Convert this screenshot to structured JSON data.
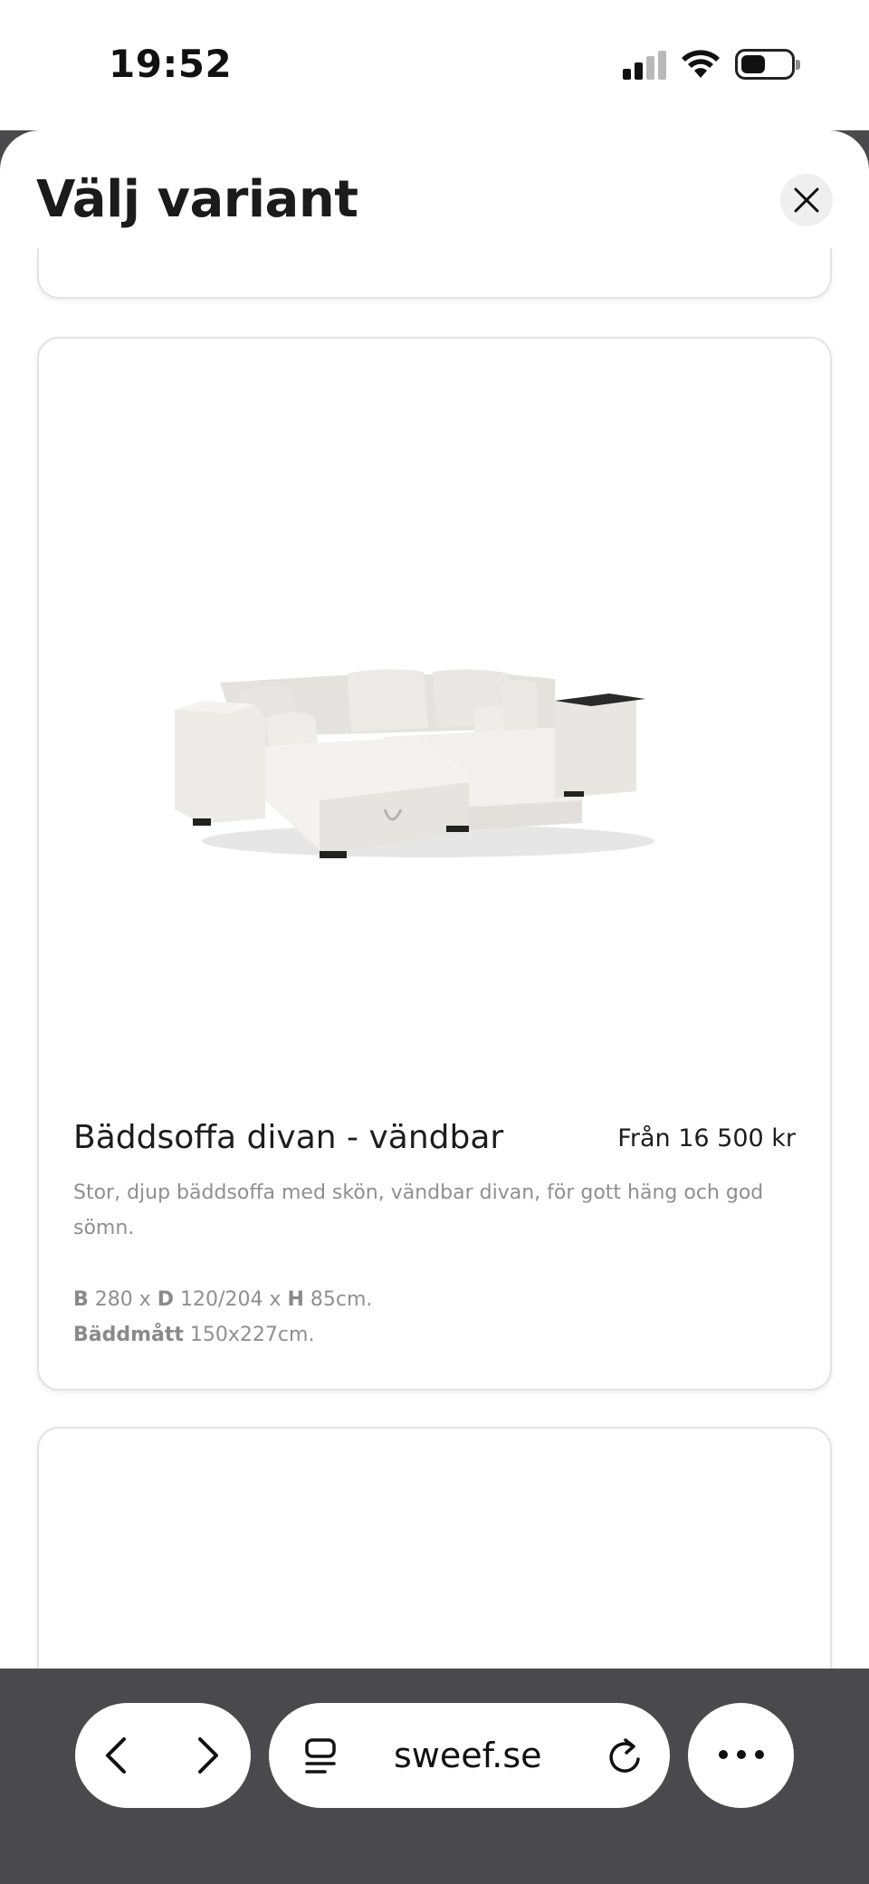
{
  "status_bar": {
    "time": "19:52"
  },
  "sheet": {
    "title": "Välj variant",
    "close_icon": "close-icon"
  },
  "product": {
    "title": "Bäddsoffa divan - vändbar",
    "price": "Från 16 500 kr",
    "description": "Stor, djup bäddsoffa med skön, vändbar divan, för gott häng och god sömn.",
    "dims_b_label": "B",
    "dims_b_value": "280 x",
    "dims_d_label": "D",
    "dims_d_value": "120/204 x",
    "dims_h_label": "H",
    "dims_h_value": "85cm.",
    "bed_label": "Bäddmått",
    "bed_value": "150x227cm.",
    "image_icon": "sofa-image"
  },
  "browser": {
    "url": "sweef.se",
    "back_icon": "chevron-left-icon",
    "forward_icon": "chevron-right-icon",
    "reader_icon": "reader-icon",
    "reload_icon": "reload-icon",
    "more_icon": "more-icon"
  }
}
